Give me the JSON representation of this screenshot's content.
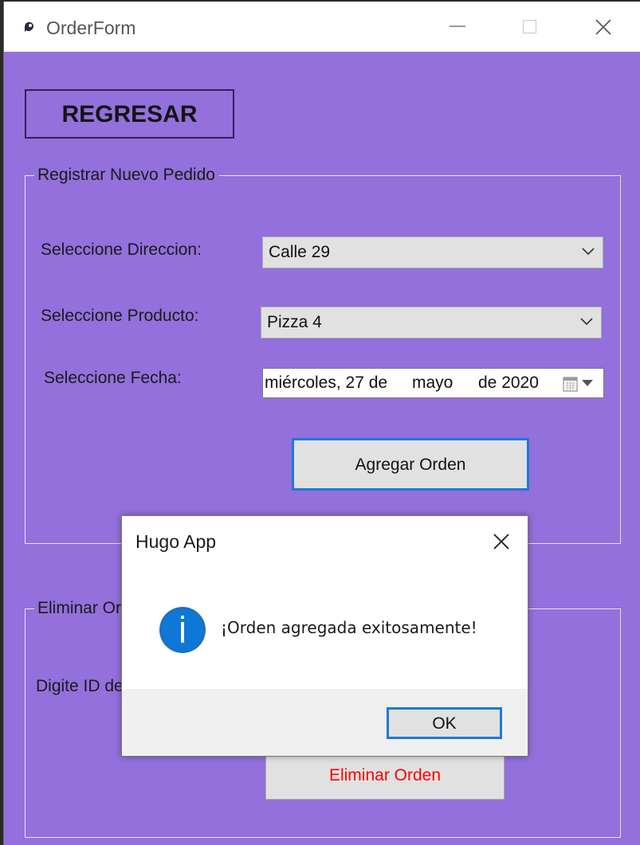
{
  "window": {
    "title": "OrderForm",
    "icon": "app-icon",
    "controls": [
      "minimize-icon",
      "maximize-icon",
      "close-icon"
    ],
    "background": "#9370db"
  },
  "regresar_label": "REGRESAR",
  "register_group": {
    "legend": "Registrar Nuevo Pedido",
    "address_label": "Seleccione Direccion:",
    "address_value": "Calle 29",
    "product_label": "Seleccione Producto:",
    "product_value": "Pizza 4",
    "date_label": "Seleccione Fecha:",
    "date_weekday_day": "miércoles, 27 de",
    "date_month": "mayo",
    "date_year": "de 2020",
    "add_button": "Agregar Orden"
  },
  "delete_group": {
    "legend": "Eliminar Orc",
    "id_label": "Digite ID de",
    "delete_button": "Eliminar Orden",
    "delete_button_color": "#ff0000"
  },
  "dialog": {
    "title": "Hugo App",
    "icon": "info-icon",
    "message": "¡Orden agregada exitosamente!",
    "ok_label": "OK",
    "accent": "#1e7ad4"
  }
}
